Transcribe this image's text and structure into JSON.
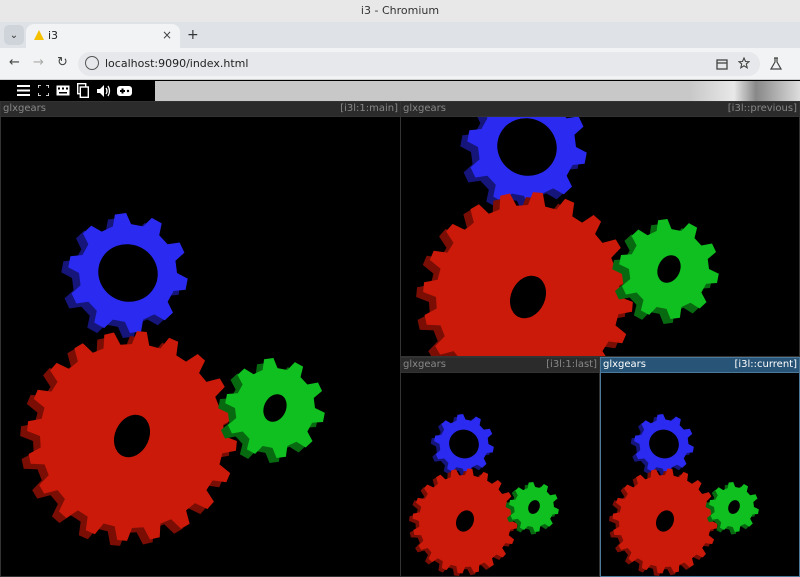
{
  "window": {
    "title": "i3 - Chromium"
  },
  "tabs": [
    {
      "title": "i3",
      "close": "×"
    }
  ],
  "new_tab": "+",
  "tab_menu": "⌄",
  "nav": {
    "back": "←",
    "forward": "→",
    "reload": "↻"
  },
  "omnibox": {
    "url": "localhost:9090/index.html"
  },
  "toolbox": {
    "icons": [
      "menu-icon",
      "fullscreen-icon",
      "keyboard-icon",
      "clipboard-icon",
      "volume-icon",
      "gamepad-icon"
    ]
  },
  "windows": [
    {
      "name": "glxgears",
      "mark": "[i3l:1:main]",
      "focused": false
    },
    {
      "name": "glxgears",
      "mark": "[i3l::previous]",
      "focused": false
    },
    {
      "name": "glxgears",
      "mark": "[i3l:1:last]",
      "focused": false
    },
    {
      "name": "glxgears",
      "mark": "[i3l::current]",
      "focused": true
    }
  ],
  "colors": {
    "red_gear": "#cc1a0a",
    "green_gear": "#10c020",
    "blue_gear": "#2a2af0",
    "focused_title": "#285577"
  }
}
